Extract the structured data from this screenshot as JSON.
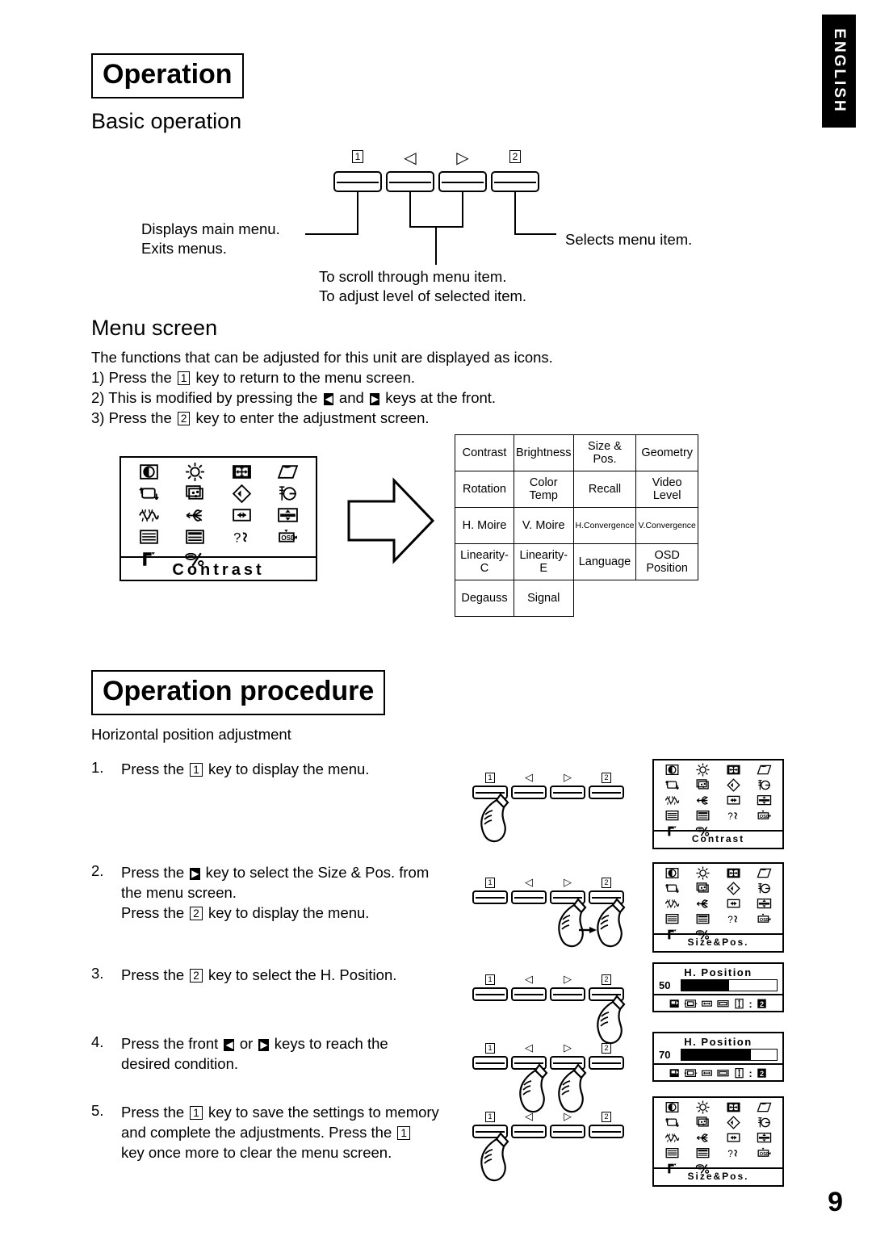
{
  "page": {
    "side_tab": "ENGLISH",
    "page_number": "9"
  },
  "section_operation": {
    "title": "Operation",
    "basic_heading": "Basic operation",
    "button_labels": [
      "1",
      "◁",
      "▷",
      "2"
    ],
    "callouts": {
      "left_line1": "Displays main menu.",
      "left_line2": "Exits menus.",
      "right": "Selects menu item.",
      "bottom_line1": "To scroll through menu item.",
      "bottom_line2": "To adjust level of selected item."
    }
  },
  "section_menu_screen": {
    "heading": "Menu screen",
    "intro": "The functions that can be adjusted for this unit are displayed as icons.",
    "steps": [
      {
        "num": "1)",
        "before": "Press the ",
        "key": "1",
        "after": " key to return to the menu screen."
      },
      {
        "num": "2)",
        "before": "This is modified by pressing the ",
        "key": "◀",
        "mid": " and ",
        "key2": "▶",
        "after": " keys at the front."
      },
      {
        "num": "3)",
        "before": "Press the ",
        "key": "2",
        "after": " key to enter the adjustment screen."
      }
    ],
    "osd_panel": {
      "footer": "Contrast",
      "icons": [
        "contrast-icon",
        "brightness-icon",
        "size-position-icon",
        "geometry-icon",
        "rotation-icon",
        "color-temp-icon",
        "recall-icon",
        "video-level-icon",
        "h-moire-icon",
        "v-moire-icon",
        "h-convergence-icon",
        "v-convergence-icon",
        "linearity-c-icon",
        "linearity-e-icon",
        "language-icon",
        "osd-position-icon",
        "degauss-icon",
        "signal-icon"
      ]
    },
    "menu_table": {
      "rows": [
        [
          "Contrast",
          "Brightness",
          "Size & Pos.",
          "Geometry"
        ],
        [
          "Rotation",
          "Color Temp",
          "Recall",
          "Video Level"
        ],
        [
          "H. Moire",
          "V. Moire",
          "H.Convergence",
          "V.Convergence"
        ],
        [
          "Linearity-C",
          "Linearity-E",
          "Language",
          "OSD\nPosition"
        ],
        [
          "Degauss",
          "Signal",
          "",
          ""
        ]
      ],
      "small_cells": [
        "H.Convergence",
        "V.Convergence"
      ]
    }
  },
  "section_procedure": {
    "title": "Operation procedure",
    "subtitle": "Horizontal position adjustment",
    "steps": [
      {
        "num": "1.",
        "lines": [
          {
            "parts": [
              {
                "t": "Press the "
              },
              {
                "key": "1"
              },
              {
                "t": " key to display the menu."
              }
            ]
          }
        ],
        "button_labels": [
          "1",
          "◁",
          "▷",
          "2"
        ],
        "hands": [
          0
        ],
        "osd": {
          "type": "menu",
          "footer": "Contrast"
        }
      },
      {
        "num": "2.",
        "lines": [
          {
            "parts": [
              {
                "t": "Press the "
              },
              {
                "keyblk": "▶"
              },
              {
                "t": " key to select the Size & Pos. from"
              }
            ]
          },
          {
            "parts": [
              {
                "t": "the menu screen."
              }
            ]
          },
          {
            "parts": [
              {
                "t": "Press the "
              },
              {
                "key": "2"
              },
              {
                "t": " key to display the menu."
              }
            ]
          }
        ],
        "button_labels": [
          "1",
          "◁",
          "▷",
          "2"
        ],
        "hands": [
          2,
          3
        ],
        "arrow_between": true,
        "osd": {
          "type": "menu",
          "footer": "Size&Pos."
        }
      },
      {
        "num": "3.",
        "lines": [
          {
            "parts": [
              {
                "t": "Press the "
              },
              {
                "key": "2"
              },
              {
                "t": " key to select the H. Position."
              }
            ]
          }
        ],
        "button_labels": [
          "1",
          "◁",
          "▷",
          "2"
        ],
        "hands": [
          3
        ],
        "osd": {
          "type": "adjust",
          "title": "H. Position",
          "value": "50",
          "percent": 50
        }
      },
      {
        "num": "4.",
        "lines": [
          {
            "parts": [
              {
                "t": "Press the front "
              },
              {
                "keyblk": "◀"
              },
              {
                "t": " or "
              },
              {
                "keyblk": "▶"
              },
              {
                "t": " keys to reach the"
              }
            ]
          },
          {
            "parts": [
              {
                "t": "desired condition."
              }
            ]
          }
        ],
        "button_labels": [
          "1",
          "◁",
          "▷",
          "2"
        ],
        "hands": [
          1,
          2
        ],
        "osd": {
          "type": "adjust",
          "title": "H. Position",
          "value": "70",
          "percent": 73
        }
      },
      {
        "num": "5.",
        "lines": [
          {
            "parts": [
              {
                "t": "Press the "
              },
              {
                "key": "1"
              },
              {
                "t": " key to save the settings to memory"
              }
            ]
          },
          {
            "parts": [
              {
                "t": "and complete the adjustments. Press the "
              },
              {
                "key": "1"
              }
            ]
          },
          {
            "parts": [
              {
                "t": "key once more to clear the menu screen."
              }
            ]
          }
        ],
        "button_labels": [
          "1",
          "◁",
          "▷",
          "2"
        ],
        "hands": [
          0
        ],
        "osd": {
          "type": "menu",
          "footer": "Size&Pos."
        }
      }
    ],
    "adjust_bottom_icons": [
      "recall-small-icon",
      "h-size-icon",
      "h-position-icon",
      "v-size-icon",
      "v-position-icon",
      "colon",
      "key-2-icon"
    ]
  }
}
